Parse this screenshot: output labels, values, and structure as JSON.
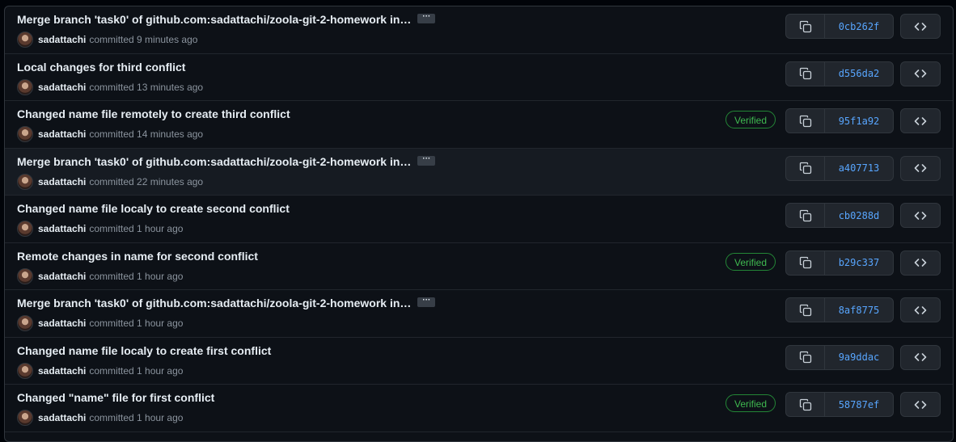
{
  "commits": [
    {
      "title": "Merge branch 'task0' of github.com:sadattachi/zoola-git-2-homework in…",
      "has_more": true,
      "author": "sadattachi",
      "time": "committed 9 minutes ago",
      "verified": "",
      "sha": "0cb262f"
    },
    {
      "title": "Local changes for third conflict",
      "has_more": false,
      "author": "sadattachi",
      "time": "committed 13 minutes ago",
      "verified": "",
      "sha": "d556da2"
    },
    {
      "title": "Changed name file remotely to create third conflict",
      "has_more": false,
      "author": "sadattachi",
      "time": "committed 14 minutes ago",
      "verified": "Verified",
      "sha": "95f1a92"
    },
    {
      "title": "Merge branch 'task0' of github.com:sadattachi/zoola-git-2-homework in…",
      "has_more": true,
      "author": "sadattachi",
      "time": "committed 22 minutes ago",
      "verified": "",
      "sha": "a407713"
    },
    {
      "title": "Changed name file localy to create second conflict",
      "has_more": false,
      "author": "sadattachi",
      "time": "committed 1 hour ago",
      "verified": "",
      "sha": "cb0288d"
    },
    {
      "title": "Remote changes in name for second conflict",
      "has_more": false,
      "author": "sadattachi",
      "time": "committed 1 hour ago",
      "verified": "Verified",
      "sha": "b29c337"
    },
    {
      "title": "Merge branch 'task0' of github.com:sadattachi/zoola-git-2-homework in…",
      "has_more": true,
      "author": "sadattachi",
      "time": "committed 1 hour ago",
      "verified": "",
      "sha": "8af8775"
    },
    {
      "title": "Changed name file localy to create first conflict",
      "has_more": false,
      "author": "sadattachi",
      "time": "committed 1 hour ago",
      "verified": "",
      "sha": "9a9ddac"
    },
    {
      "title": "Changed \"name\" file for first conflict",
      "has_more": false,
      "author": "sadattachi",
      "time": "committed 1 hour ago",
      "verified": "Verified",
      "sha": "58787ef"
    }
  ],
  "ellipsis_label": "···",
  "hovered_index": 3,
  "icons": {
    "copy": "copy-icon",
    "browse": "code-icon",
    "avatar": "avatar"
  },
  "colors": {
    "background": "#0d1117",
    "sha": "#58a6ff",
    "verified": "#3fb950",
    "border": "#30363d"
  }
}
